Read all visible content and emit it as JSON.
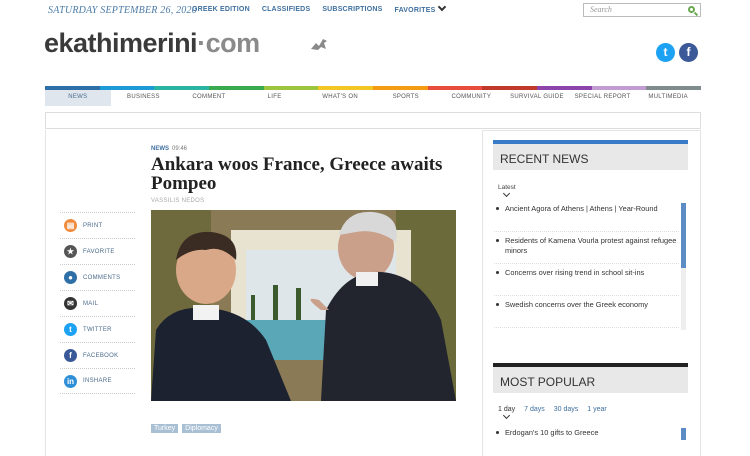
{
  "header": {
    "date": "SATURDAY SEPTEMBER 26, 2020",
    "links": [
      "GREEK EDITION",
      "CLASSIFIEDS",
      "SUBSCRIPTIONS",
      "FAVORITES"
    ],
    "search_placeholder": "Search",
    "logo_main": "ekathimerini",
    "logo_dot": "·",
    "logo_tld": "com"
  },
  "nav": {
    "colors": [
      "#2f6fa8",
      "#1e9bd7",
      "#2bb3a4",
      "#3aa84d",
      "#9bc53d",
      "#f3c623",
      "#f39c12",
      "#e74c3c",
      "#c0392b",
      "#8e44ad",
      "#c39bd3",
      "#7f8c8d"
    ],
    "items": [
      "NEWS",
      "BUSINESS",
      "COMMENT",
      "LIFE",
      "WHAT'S ON",
      "SPORTS",
      "COMMUNITY",
      "SURVIVAL GUIDE",
      "SPECIAL REPORT",
      "MULTIMEDIA"
    ]
  },
  "article": {
    "section": "NEWS",
    "time": "09:46",
    "title": "Ankara woos France, Greece awaits Pompeo",
    "byline": "VASSILIS NEDOS",
    "tags": [
      "Turkey",
      "Diplomacy"
    ]
  },
  "tools": [
    {
      "label": "PRINT",
      "icon": "print-icon",
      "color": "#f08a3c"
    },
    {
      "label": "FAVORITE",
      "icon": "star-icon",
      "color": "#555555"
    },
    {
      "label": "COMMENTS",
      "icon": "comment-icon",
      "color": "#2f6fa8"
    },
    {
      "label": "MAIL",
      "icon": "mail-icon",
      "color": "#333333"
    },
    {
      "label": "TWITTER",
      "icon": "twitter-icon",
      "color": "#1da1f2"
    },
    {
      "label": "FACEBOOK",
      "icon": "facebook-icon",
      "color": "#3b5998"
    },
    {
      "label": "INSHARE",
      "icon": "linkedin-icon",
      "color": "#2f8fd6"
    }
  ],
  "sidebar": {
    "recent_title": "RECENT NEWS",
    "latest_label": "Latest",
    "recent_items": [
      "Ancient Agora of Athens | Athens | Year-Round",
      "Residents of Kamena Vourla protest against refugee minors",
      "Concerns over rising trend in school sit-ins",
      "Swedish concerns over the Greek economy"
    ],
    "popular_title": "MOST POPULAR",
    "periods": [
      "1 day",
      "7 days",
      "30 days",
      "1 year"
    ],
    "popular_items": [
      "Erdogan's 10 gifts to Greece"
    ]
  }
}
